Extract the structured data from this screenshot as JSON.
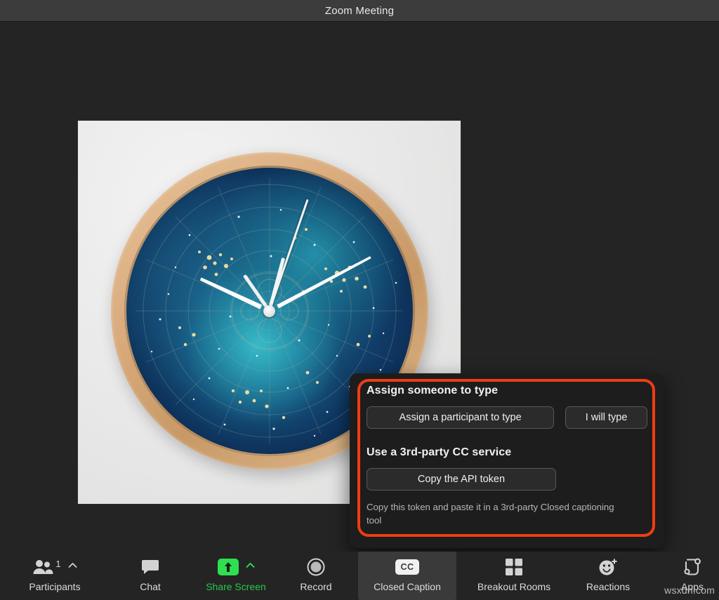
{
  "window": {
    "title": "Zoom Meeting"
  },
  "shared_content": {
    "description": "Shared screen photo of a round wall clock with a wooden rim and a deep blue star-map constellation dial",
    "clock": {
      "rim_color": "#d9ab7d",
      "dial_color": "#113f6b",
      "hands_color": "#fdfdfd"
    },
    "wall_color": "#e9e9e9"
  },
  "cc_popup": {
    "highlight_color": "#ef3c14",
    "background_color": "#1d1d1d",
    "assign_heading": "Assign someone to type",
    "assign_participant_button": "Assign a participant to type",
    "i_will_type_button": "I will type",
    "third_party_heading": "Use a 3rd-party CC service",
    "copy_api_token_button": "Copy the API token",
    "note": "Copy this token and paste it in a 3rd-party Closed captioning tool"
  },
  "toolbar": {
    "items": [
      {
        "label": "Participants",
        "icon": "participants-icon",
        "count": "1",
        "has_chevron": true,
        "active": false
      },
      {
        "label": "Chat",
        "icon": "chat-icon",
        "count": "",
        "has_chevron": false,
        "active": false
      },
      {
        "label": "Share Screen",
        "icon": "share-screen-icon",
        "count": "",
        "has_chevron": true,
        "active": false
      },
      {
        "label": "Record",
        "icon": "record-icon",
        "count": "",
        "has_chevron": false,
        "active": false
      },
      {
        "label": "Closed Caption",
        "icon": "closed-caption-icon",
        "count": "",
        "has_chevron": false,
        "active": true
      },
      {
        "label": "Breakout Rooms",
        "icon": "breakout-rooms-icon",
        "count": "",
        "has_chevron": false,
        "active": false
      },
      {
        "label": "Reactions",
        "icon": "reactions-icon",
        "count": "",
        "has_chevron": false,
        "active": false
      },
      {
        "label": "Apps",
        "icon": "apps-icon",
        "count": "",
        "has_chevron": false,
        "active": false
      }
    ],
    "share_accent_color": "#27c84a"
  },
  "watermark": {
    "text": "wsxdn.com"
  }
}
